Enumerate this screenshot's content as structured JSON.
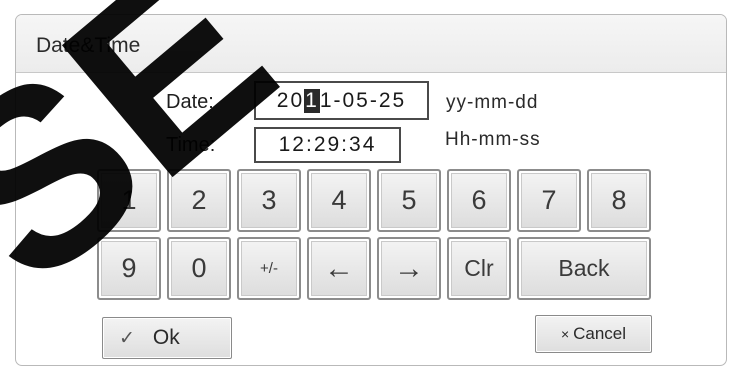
{
  "dialog": {
    "title": "Date&Time"
  },
  "date": {
    "label": "Date:",
    "value_before": "20",
    "value_cursor": "1",
    "value_after": "1-05-25",
    "format": "yy-mm-dd"
  },
  "time": {
    "label": "Time:",
    "value": "12:29:34",
    "format": "Hh-mm-ss"
  },
  "keypad": {
    "row1": [
      "1",
      "2",
      "3",
      "4",
      "5",
      "6",
      "7",
      "8"
    ],
    "row2": [
      "9",
      "0",
      "+/-",
      "←",
      "→",
      "Clr",
      "Back"
    ]
  },
  "actions": {
    "ok_icon": "✓",
    "ok_label": "Ok",
    "cancel_icon": "×",
    "cancel_label": "Cancel"
  },
  "watermark_text": "SE",
  "colors": {
    "key_border": "#8c8c8c",
    "field_border": "#4a4a4a",
    "watermark": "#000000"
  }
}
